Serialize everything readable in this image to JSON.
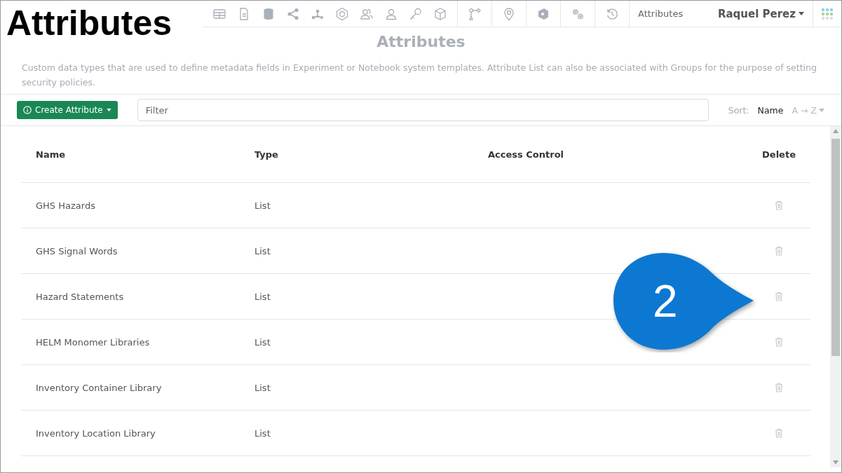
{
  "overlay_title": "Attributes",
  "nav": {
    "breadcrumb": "Attributes",
    "user": "Raquel Perez"
  },
  "page": {
    "title": "Attributes",
    "description": "Custom data types that are used to define metadata fields in Experiment or Notebook system templates. Attribute List can also be associated with Groups for the purpose of setting security policies."
  },
  "toolbar": {
    "create_button": "Create Attribute",
    "filter": {
      "placeholder": "Filter"
    },
    "sort_label": "Sort:",
    "sort_field": "Name",
    "sort_order": "A → Z"
  },
  "table": {
    "columns": [
      "Name",
      "Type",
      "Access Control",
      "Delete"
    ],
    "rows": [
      {
        "name": "GHS Hazards",
        "type": "List"
      },
      {
        "name": "GHS Signal Words",
        "type": "List"
      },
      {
        "name": "Hazard Statements",
        "type": "List"
      },
      {
        "name": "HELM Monomer Libraries",
        "type": "List"
      },
      {
        "name": "Inventory Container Library",
        "type": "List"
      },
      {
        "name": "Inventory Location Library",
        "type": "List"
      }
    ]
  },
  "callout": {
    "label": "2"
  }
}
